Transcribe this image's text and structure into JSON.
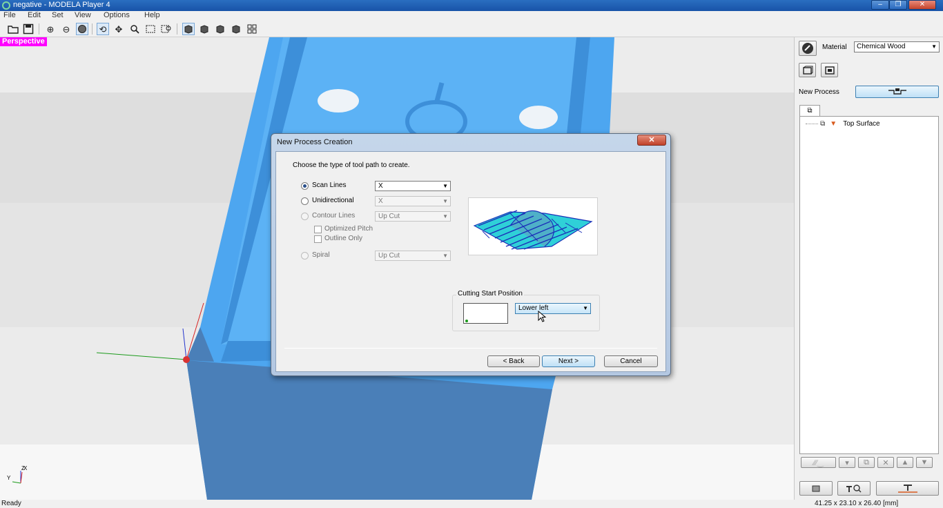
{
  "window": {
    "title": "negative - MODELA Player 4",
    "controls": {
      "minimize": "–",
      "maximize": "❐",
      "close": "✕"
    }
  },
  "menu": [
    "File",
    "Edit",
    "Set",
    "View",
    "Options",
    "Help"
  ],
  "viewport": {
    "label": "Perspective",
    "axis_labels": {
      "z": "Z",
      "x": "X",
      "y": "Y"
    }
  },
  "right_panel": {
    "material_label": "Material",
    "material_value": "Chemical Wood",
    "new_process_label": "New Process",
    "tree_items": [
      {
        "label": "Top Surface"
      }
    ]
  },
  "dialog": {
    "title": "New Process Creation",
    "close_label": "✕",
    "instruction": "Choose the type of tool path to create.",
    "options": {
      "scan_lines": {
        "label": "Scan Lines",
        "value": "X"
      },
      "unidirectional": {
        "label": "Unidirectional",
        "value": "X"
      },
      "contour_lines": {
        "label": "Contour Lines",
        "value": "Up Cut"
      },
      "optimized_pitch": {
        "label": "Optimized Pitch"
      },
      "outline_only": {
        "label": "Outline Only"
      },
      "spiral": {
        "label": "Spiral",
        "value": "Up Cut"
      }
    },
    "cutting_start": {
      "group_title": "Cutting Start Position",
      "value": "Lower left"
    },
    "buttons": {
      "back": "< Back",
      "next": "Next >",
      "cancel": "Cancel"
    }
  },
  "status": {
    "left": "Ready",
    "right": "41.25 x 23.10 x 26.40 [mm]"
  },
  "colors": {
    "model": "#4da6f0",
    "model_dark": "#4a7fb8",
    "perspective_tag": "#ff00ff",
    "titlebar": "#1e5eb5"
  }
}
